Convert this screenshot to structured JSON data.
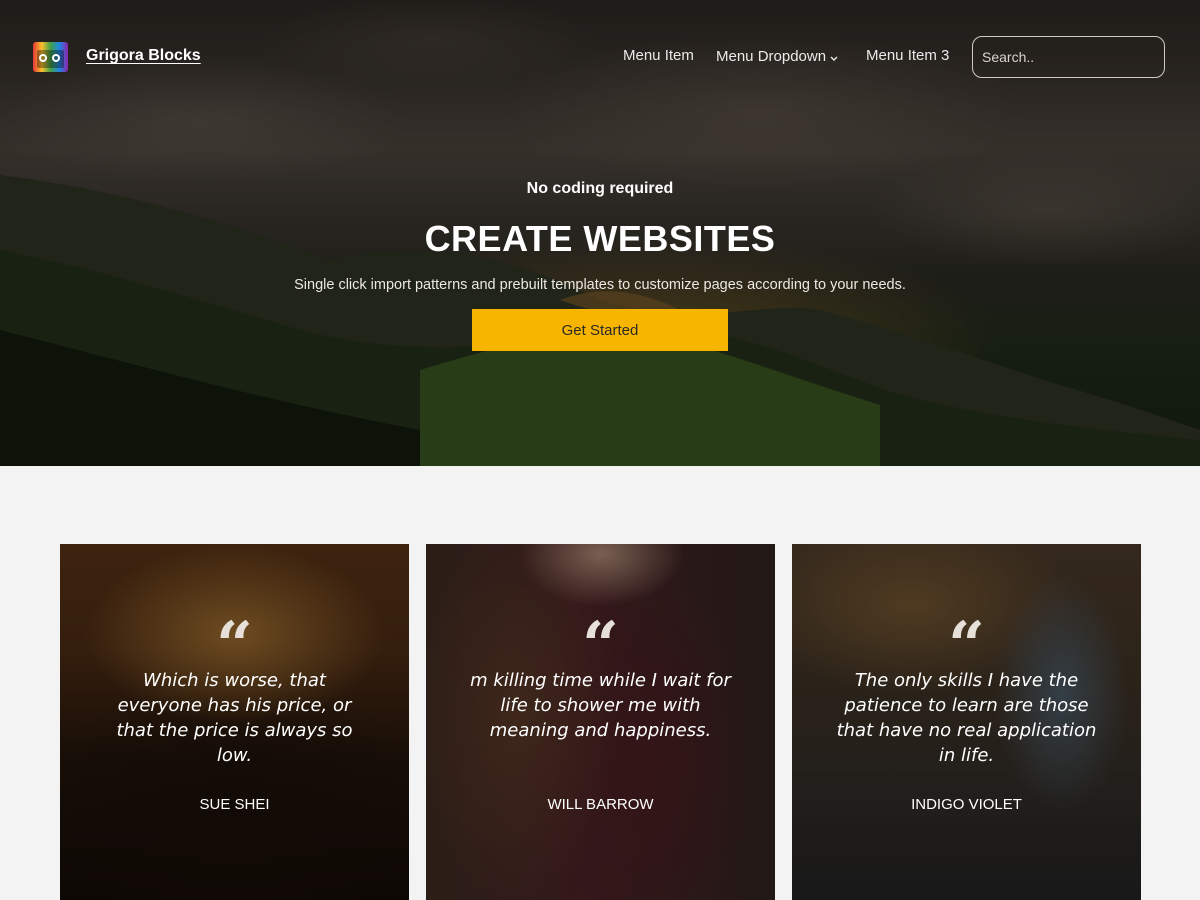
{
  "header": {
    "brand": "Grigora Blocks",
    "nav": [
      {
        "label": "Menu Item",
        "has_dropdown": false
      },
      {
        "label": "Menu Dropdown",
        "has_dropdown": true
      },
      {
        "label": "Menu Item 3",
        "has_dropdown": false
      }
    ],
    "search": {
      "placeholder": "Search..",
      "value": ""
    }
  },
  "hero": {
    "kicker": "No coding required",
    "headline": "CREATE WEBSITES",
    "subtext": "Single click import patterns and prebuilt templates to customize pages according to your needs.",
    "cta_label": "Get Started"
  },
  "testimonials": [
    {
      "quote": "Which is worse, that everyone has his price, or that the price is always so low.",
      "author": "SUE SHEI"
    },
    {
      "quote": "m killing time while I wait for life to shower me with meaning and happiness.",
      "author": "WILL BARROW"
    },
    {
      "quote": "The only skills I have the patience to learn are those that have no real application in life.",
      "author": "INDIGO VIOLET"
    }
  ],
  "colors": {
    "accent": "#f7b500",
    "page_background": "#f3f3f3",
    "cta_text": "#2c2a26"
  },
  "icons": {
    "logo": "radio-icon",
    "quote": "quote-icon",
    "dropdown": "chevron-down-icon"
  }
}
